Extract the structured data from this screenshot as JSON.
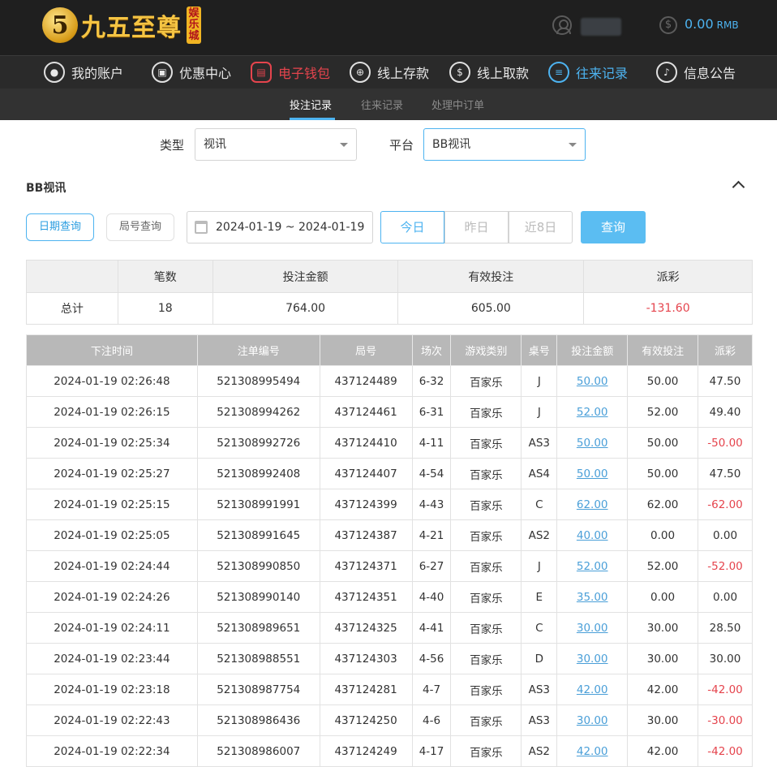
{
  "header": {
    "logo_number": "5",
    "logo_text": "九五至尊",
    "logo_badge": "娱乐城",
    "balance": "0.00",
    "currency": "RMB"
  },
  "nav": {
    "items": [
      {
        "label": "我的账户",
        "icon": "user-icon"
      },
      {
        "label": "优惠中心",
        "icon": "gift-icon"
      },
      {
        "label": "电子钱包",
        "icon": "wallet-icon"
      },
      {
        "label": "线上存款",
        "icon": "deposit-icon"
      },
      {
        "label": "线上取款",
        "icon": "withdraw-icon"
      },
      {
        "label": "往来记录",
        "icon": "record-icon"
      },
      {
        "label": "信息公告",
        "icon": "bell-icon"
      }
    ]
  },
  "subnav": {
    "items": [
      "投注记录",
      "往来记录",
      "处理中订单"
    ]
  },
  "filters": {
    "type_label": "类型",
    "type_value": "视讯",
    "platform_label": "平台",
    "platform_value": "BB视讯"
  },
  "section": {
    "title": "BB视讯",
    "date_query": "日期查询",
    "round_query": "局号查询",
    "date_range": "2024-01-19 ~ 2024-01-19",
    "today": "今日",
    "yesterday": "昨日",
    "last8": "近8日",
    "query": "查询"
  },
  "summary": {
    "headers": [
      "",
      "笔数",
      "投注金额",
      "有效投注",
      "派彩"
    ],
    "row": [
      "总计",
      "18",
      "764.00",
      "605.00",
      "-131.60"
    ]
  },
  "details": {
    "headers": [
      "下注时间",
      "注单编号",
      "局号",
      "场次",
      "游戏类别",
      "桌号",
      "投注金额",
      "有效投注",
      "派彩"
    ],
    "rows": [
      [
        "2024-01-19 02:26:48",
        "521308995494",
        "437124489",
        "6-32",
        "百家乐",
        "J",
        "50.00",
        "50.00",
        "47.50"
      ],
      [
        "2024-01-19 02:26:15",
        "521308994262",
        "437124461",
        "6-31",
        "百家乐",
        "J",
        "52.00",
        "52.00",
        "49.40"
      ],
      [
        "2024-01-19 02:25:34",
        "521308992726",
        "437124410",
        "4-11",
        "百家乐",
        "AS3",
        "50.00",
        "50.00",
        "-50.00"
      ],
      [
        "2024-01-19 02:25:27",
        "521308992408",
        "437124407",
        "4-54",
        "百家乐",
        "AS4",
        "50.00",
        "50.00",
        "47.50"
      ],
      [
        "2024-01-19 02:25:15",
        "521308991991",
        "437124399",
        "4-43",
        "百家乐",
        "C",
        "62.00",
        "62.00",
        "-62.00"
      ],
      [
        "2024-01-19 02:25:05",
        "521308991645",
        "437124387",
        "4-21",
        "百家乐",
        "AS2",
        "40.00",
        "0.00",
        "0.00"
      ],
      [
        "2024-01-19 02:24:44",
        "521308990850",
        "437124371",
        "6-27",
        "百家乐",
        "J",
        "52.00",
        "52.00",
        "-52.00"
      ],
      [
        "2024-01-19 02:24:26",
        "521308990140",
        "437124351",
        "4-40",
        "百家乐",
        "E",
        "35.00",
        "0.00",
        "0.00"
      ],
      [
        "2024-01-19 02:24:11",
        "521308989651",
        "437124325",
        "4-41",
        "百家乐",
        "C",
        "30.00",
        "30.00",
        "28.50"
      ],
      [
        "2024-01-19 02:23:44",
        "521308988551",
        "437124303",
        "4-56",
        "百家乐",
        "D",
        "30.00",
        "30.00",
        "30.00"
      ],
      [
        "2024-01-19 02:23:18",
        "521308987754",
        "437124281",
        "4-7",
        "百家乐",
        "AS3",
        "42.00",
        "42.00",
        "-42.00"
      ],
      [
        "2024-01-19 02:22:43",
        "521308986436",
        "437124250",
        "4-6",
        "百家乐",
        "AS3",
        "30.00",
        "30.00",
        "-30.00"
      ],
      [
        "2024-01-19 02:22:34",
        "521308986007",
        "437124249",
        "4-17",
        "百家乐",
        "AS2",
        "42.00",
        "42.00",
        "-42.00"
      ]
    ]
  },
  "colors": {
    "accent": "#4db3f0",
    "negative": "#e5444d",
    "header_bg": "#1f1f1f",
    "table_head": "#b8b8b8"
  }
}
